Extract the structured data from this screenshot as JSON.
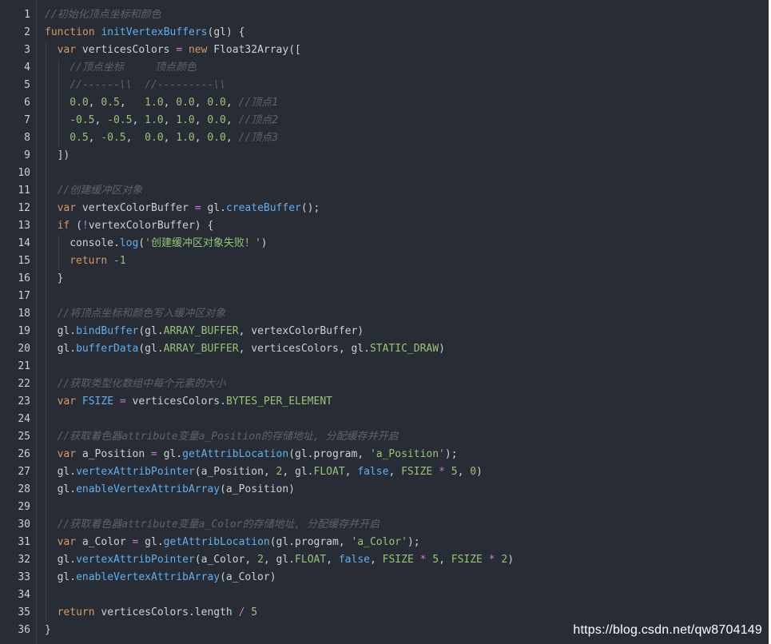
{
  "colors": {
    "background": "#282c34",
    "comment": "#5c6370",
    "keyword": "#d19a66",
    "function": "#61afef",
    "string": "#98c379",
    "number": "#98c379",
    "operator": "#c678dd",
    "plain": "#c9d1d9"
  },
  "watermark": "https://blog.csdn.net/qw8704149",
  "lines": [
    {
      "n": "1",
      "indent": 0,
      "tokens": [
        {
          "t": "//初始化顶点坐标和颜色",
          "c": "cm"
        }
      ]
    },
    {
      "n": "2",
      "indent": 0,
      "tokens": [
        {
          "t": "function",
          "c": "kw"
        },
        {
          "t": " ",
          "c": "pl"
        },
        {
          "t": "initVertexBuffers",
          "c": "fn"
        },
        {
          "t": "(gl) {",
          "c": "pl"
        }
      ]
    },
    {
      "n": "3",
      "indent": 1,
      "tokens": [
        {
          "t": "var",
          "c": "kw"
        },
        {
          "t": " verticesColors ",
          "c": "pl"
        },
        {
          "t": "=",
          "c": "op"
        },
        {
          "t": " ",
          "c": "pl"
        },
        {
          "t": "new",
          "c": "kw"
        },
        {
          "t": " Float32Array([",
          "c": "pl"
        }
      ]
    },
    {
      "n": "4",
      "indent": 2,
      "tokens": [
        {
          "t": "//顶点坐标     顶点颜色",
          "c": "cm"
        }
      ]
    },
    {
      "n": "5",
      "indent": 2,
      "tokens": [
        {
          "t": "//------\\\\  //---------\\\\",
          "c": "cm"
        }
      ]
    },
    {
      "n": "6",
      "indent": 2,
      "tokens": [
        {
          "t": "0.0",
          "c": "num"
        },
        {
          "t": ", ",
          "c": "pl"
        },
        {
          "t": "0.5",
          "c": "num"
        },
        {
          "t": ",   ",
          "c": "pl"
        },
        {
          "t": "1.0",
          "c": "num"
        },
        {
          "t": ", ",
          "c": "pl"
        },
        {
          "t": "0.0",
          "c": "num"
        },
        {
          "t": ", ",
          "c": "pl"
        },
        {
          "t": "0.0",
          "c": "num"
        },
        {
          "t": ", ",
          "c": "pl"
        },
        {
          "t": "//顶点1",
          "c": "cm"
        }
      ]
    },
    {
      "n": "7",
      "indent": 2,
      "tokens": [
        {
          "t": "-0.5",
          "c": "num"
        },
        {
          "t": ", ",
          "c": "pl"
        },
        {
          "t": "-0.5",
          "c": "num"
        },
        {
          "t": ", ",
          "c": "pl"
        },
        {
          "t": "1.0",
          "c": "num"
        },
        {
          "t": ", ",
          "c": "pl"
        },
        {
          "t": "1.0",
          "c": "num"
        },
        {
          "t": ", ",
          "c": "pl"
        },
        {
          "t": "0.0",
          "c": "num"
        },
        {
          "t": ", ",
          "c": "pl"
        },
        {
          "t": "//顶点2",
          "c": "cm"
        }
      ]
    },
    {
      "n": "8",
      "indent": 2,
      "tokens": [
        {
          "t": "0.5",
          "c": "num"
        },
        {
          "t": ", ",
          "c": "pl"
        },
        {
          "t": "-0.5",
          "c": "num"
        },
        {
          "t": ",  ",
          "c": "pl"
        },
        {
          "t": "0.0",
          "c": "num"
        },
        {
          "t": ", ",
          "c": "pl"
        },
        {
          "t": "1.0",
          "c": "num"
        },
        {
          "t": ", ",
          "c": "pl"
        },
        {
          "t": "0.0",
          "c": "num"
        },
        {
          "t": ", ",
          "c": "pl"
        },
        {
          "t": "//顶点3",
          "c": "cm"
        }
      ]
    },
    {
      "n": "9",
      "indent": 1,
      "tokens": [
        {
          "t": "])",
          "c": "pl"
        }
      ]
    },
    {
      "n": "10",
      "indent": 1,
      "tokens": []
    },
    {
      "n": "11",
      "indent": 1,
      "tokens": [
        {
          "t": "//创建缓冲区对象",
          "c": "cm"
        }
      ]
    },
    {
      "n": "12",
      "indent": 1,
      "tokens": [
        {
          "t": "var",
          "c": "kw"
        },
        {
          "t": " vertexColorBuffer ",
          "c": "pl"
        },
        {
          "t": "=",
          "c": "op"
        },
        {
          "t": " gl.",
          "c": "pl"
        },
        {
          "t": "createBuffer",
          "c": "fn"
        },
        {
          "t": "();",
          "c": "pl"
        }
      ]
    },
    {
      "n": "13",
      "indent": 1,
      "tokens": [
        {
          "t": "if",
          "c": "kw"
        },
        {
          "t": " (",
          "c": "pl"
        },
        {
          "t": "!",
          "c": "op"
        },
        {
          "t": "vertexColorBuffer) {",
          "c": "pl"
        }
      ]
    },
    {
      "n": "14",
      "indent": 2,
      "tokens": [
        {
          "t": "console.",
          "c": "pl"
        },
        {
          "t": "log",
          "c": "fn"
        },
        {
          "t": "(",
          "c": "pl"
        },
        {
          "t": "'创建缓冲区对象失败！'",
          "c": "str"
        },
        {
          "t": ")",
          "c": "pl"
        }
      ]
    },
    {
      "n": "15",
      "indent": 2,
      "tokens": [
        {
          "t": "return",
          "c": "kw"
        },
        {
          "t": " ",
          "c": "pl"
        },
        {
          "t": "-1",
          "c": "num"
        }
      ]
    },
    {
      "n": "16",
      "indent": 1,
      "tokens": [
        {
          "t": "}",
          "c": "pl"
        }
      ]
    },
    {
      "n": "17",
      "indent": 1,
      "tokens": []
    },
    {
      "n": "18",
      "indent": 1,
      "tokens": [
        {
          "t": "//将顶点坐标和颜色写入缓冲区对象",
          "c": "cm"
        }
      ]
    },
    {
      "n": "19",
      "indent": 1,
      "tokens": [
        {
          "t": "gl.",
          "c": "pl"
        },
        {
          "t": "bindBuffer",
          "c": "fn"
        },
        {
          "t": "(gl.",
          "c": "pl"
        },
        {
          "t": "ARRAY_BUFFER",
          "c": "prop"
        },
        {
          "t": ", vertexColorBuffer)",
          "c": "pl"
        }
      ]
    },
    {
      "n": "20",
      "indent": 1,
      "tokens": [
        {
          "t": "gl.",
          "c": "pl"
        },
        {
          "t": "bufferData",
          "c": "fn"
        },
        {
          "t": "(gl.",
          "c": "pl"
        },
        {
          "t": "ARRAY_BUFFER",
          "c": "prop"
        },
        {
          "t": ", verticesColors, gl.",
          "c": "pl"
        },
        {
          "t": "STATIC_DRAW",
          "c": "prop"
        },
        {
          "t": ")",
          "c": "pl"
        }
      ]
    },
    {
      "n": "21",
      "indent": 1,
      "tokens": []
    },
    {
      "n": "22",
      "indent": 1,
      "tokens": [
        {
          "t": "//获取类型化数组中每个元素的大小",
          "c": "cm"
        }
      ]
    },
    {
      "n": "23",
      "indent": 1,
      "tokens": [
        {
          "t": "var",
          "c": "kw"
        },
        {
          "t": " ",
          "c": "pl"
        },
        {
          "t": "FSIZE",
          "c": "fn"
        },
        {
          "t": " ",
          "c": "pl"
        },
        {
          "t": "=",
          "c": "op"
        },
        {
          "t": " verticesColors.",
          "c": "pl"
        },
        {
          "t": "BYTES_PER_ELEMENT",
          "c": "prop"
        }
      ]
    },
    {
      "n": "24",
      "indent": 1,
      "tokens": []
    },
    {
      "n": "25",
      "indent": 1,
      "tokens": [
        {
          "t": "//获取着色器attribute变量a_Position的存储地址, 分配缓存并开启",
          "c": "cm"
        }
      ]
    },
    {
      "n": "26",
      "indent": 1,
      "tokens": [
        {
          "t": "var",
          "c": "kw"
        },
        {
          "t": " a_Position ",
          "c": "pl"
        },
        {
          "t": "=",
          "c": "op"
        },
        {
          "t": " gl.",
          "c": "pl"
        },
        {
          "t": "getAttribLocation",
          "c": "fn"
        },
        {
          "t": "(gl.program, ",
          "c": "pl"
        },
        {
          "t": "'a_Position'",
          "c": "str"
        },
        {
          "t": ");",
          "c": "pl"
        }
      ]
    },
    {
      "n": "27",
      "indent": 1,
      "tokens": [
        {
          "t": "gl.",
          "c": "pl"
        },
        {
          "t": "vertexAttribPointer",
          "c": "fn"
        },
        {
          "t": "(a_Position, ",
          "c": "pl"
        },
        {
          "t": "2",
          "c": "num"
        },
        {
          "t": ", gl.",
          "c": "pl"
        },
        {
          "t": "FLOAT",
          "c": "prop"
        },
        {
          "t": ", ",
          "c": "pl"
        },
        {
          "t": "false",
          "c": "fn"
        },
        {
          "t": ", ",
          "c": "pl"
        },
        {
          "t": "FSIZE",
          "c": "prop"
        },
        {
          "t": " ",
          "c": "pl"
        },
        {
          "t": "*",
          "c": "op"
        },
        {
          "t": " ",
          "c": "pl"
        },
        {
          "t": "5",
          "c": "num"
        },
        {
          "t": ", ",
          "c": "pl"
        },
        {
          "t": "0",
          "c": "num"
        },
        {
          "t": ")",
          "c": "pl"
        }
      ]
    },
    {
      "n": "28",
      "indent": 1,
      "tokens": [
        {
          "t": "gl.",
          "c": "pl"
        },
        {
          "t": "enableVertexAttribArray",
          "c": "fn"
        },
        {
          "t": "(a_Position)",
          "c": "pl"
        }
      ]
    },
    {
      "n": "29",
      "indent": 1,
      "tokens": []
    },
    {
      "n": "30",
      "indent": 1,
      "tokens": [
        {
          "t": "//获取着色器attribute变量a_Color的存储地址, 分配缓存并开启",
          "c": "cm"
        }
      ]
    },
    {
      "n": "31",
      "indent": 1,
      "tokens": [
        {
          "t": "var",
          "c": "kw"
        },
        {
          "t": " a_Color ",
          "c": "pl"
        },
        {
          "t": "=",
          "c": "op"
        },
        {
          "t": " gl.",
          "c": "pl"
        },
        {
          "t": "getAttribLocation",
          "c": "fn"
        },
        {
          "t": "(gl.program, ",
          "c": "pl"
        },
        {
          "t": "'a_Color'",
          "c": "str"
        },
        {
          "t": ");",
          "c": "pl"
        }
      ]
    },
    {
      "n": "32",
      "indent": 1,
      "tokens": [
        {
          "t": "gl.",
          "c": "pl"
        },
        {
          "t": "vertexAttribPointer",
          "c": "fn"
        },
        {
          "t": "(a_Color, ",
          "c": "pl"
        },
        {
          "t": "2",
          "c": "num"
        },
        {
          "t": ", gl.",
          "c": "pl"
        },
        {
          "t": "FLOAT",
          "c": "prop"
        },
        {
          "t": ", ",
          "c": "pl"
        },
        {
          "t": "false",
          "c": "fn"
        },
        {
          "t": ", ",
          "c": "pl"
        },
        {
          "t": "FSIZE",
          "c": "prop"
        },
        {
          "t": " ",
          "c": "pl"
        },
        {
          "t": "*",
          "c": "op"
        },
        {
          "t": " ",
          "c": "pl"
        },
        {
          "t": "5",
          "c": "num"
        },
        {
          "t": ", ",
          "c": "pl"
        },
        {
          "t": "FSIZE",
          "c": "prop"
        },
        {
          "t": " ",
          "c": "pl"
        },
        {
          "t": "*",
          "c": "op"
        },
        {
          "t": " ",
          "c": "pl"
        },
        {
          "t": "2",
          "c": "num"
        },
        {
          "t": ")",
          "c": "pl"
        }
      ]
    },
    {
      "n": "33",
      "indent": 1,
      "tokens": [
        {
          "t": "gl.",
          "c": "pl"
        },
        {
          "t": "enableVertexAttribArray",
          "c": "fn"
        },
        {
          "t": "(a_Color)",
          "c": "pl"
        }
      ]
    },
    {
      "n": "34",
      "indent": 1,
      "tokens": []
    },
    {
      "n": "35",
      "indent": 1,
      "tokens": [
        {
          "t": "return",
          "c": "kw"
        },
        {
          "t": " verticesColors.length ",
          "c": "pl"
        },
        {
          "t": "/",
          "c": "op"
        },
        {
          "t": " ",
          "c": "pl"
        },
        {
          "t": "5",
          "c": "num"
        }
      ]
    },
    {
      "n": "36",
      "indent": 0,
      "tokens": [
        {
          "t": "}",
          "c": "pl"
        }
      ]
    }
  ]
}
